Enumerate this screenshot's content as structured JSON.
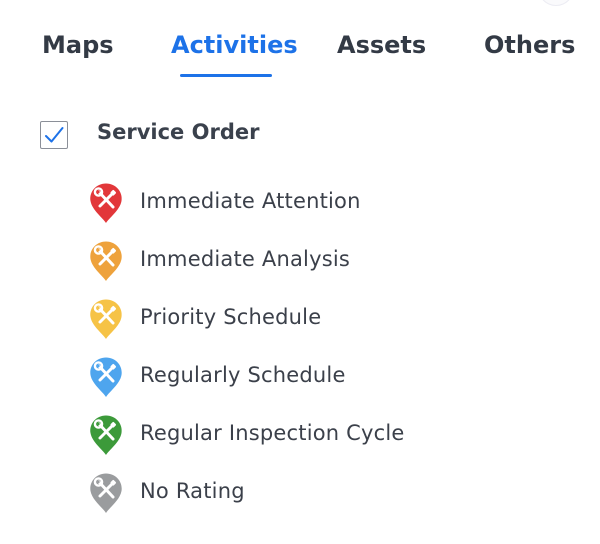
{
  "tabs": [
    {
      "label": "Maps",
      "active": false
    },
    {
      "label": "Activities",
      "active": true
    },
    {
      "label": "Assets",
      "active": false
    },
    {
      "label": "Others",
      "active": false
    }
  ],
  "colors": {
    "accent": "#1d72e8",
    "text_dark": "#333a45"
  },
  "service_order": {
    "title": "Service Order",
    "checked": true,
    "items": [
      {
        "label": "Immediate Attention",
        "color": "#e2373a",
        "icon": "wrench-screwdriver-pin-icon"
      },
      {
        "label": "Immediate Analysis",
        "color": "#eea23c",
        "icon": "wrench-screwdriver-pin-icon"
      },
      {
        "label": "Priority Schedule",
        "color": "#f6c346",
        "icon": "wrench-screwdriver-pin-icon"
      },
      {
        "label": "Regularly Schedule",
        "color": "#4ea5ee",
        "icon": "wrench-screwdriver-pin-icon"
      },
      {
        "label": "Regular Inspection Cycle",
        "color": "#3c9a3a",
        "icon": "wrench-screwdriver-pin-icon"
      },
      {
        "label": "No Rating",
        "color": "#9a9c9e",
        "icon": "wrench-screwdriver-pin-icon"
      }
    ]
  }
}
